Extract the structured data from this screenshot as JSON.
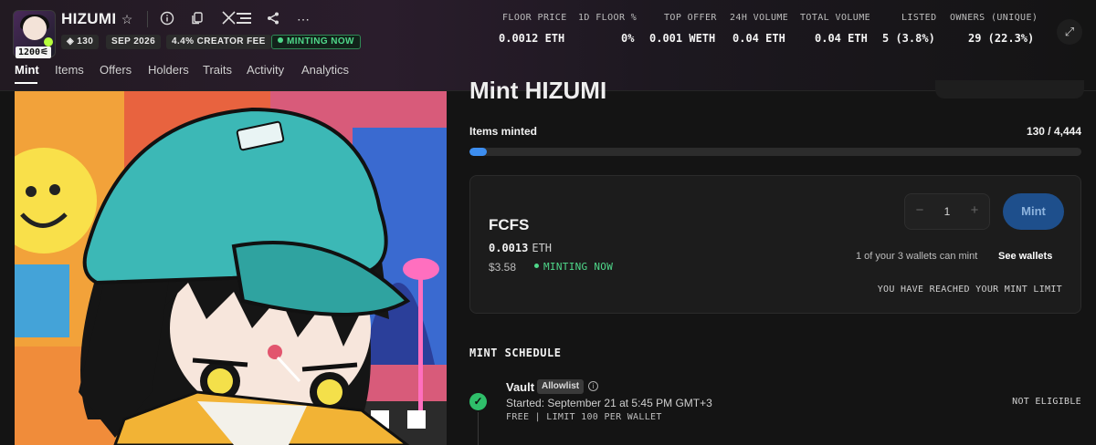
{
  "collection": {
    "name": "HIZUMI",
    "logo_badge": "1200⚟",
    "pills": {
      "items": "130",
      "date": "SEP 2026",
      "creator_fee": "4.4% CREATOR FEE",
      "status": "MINTING NOW"
    }
  },
  "header_icons": [
    "star-icon",
    "info-icon",
    "copy-icon",
    "x-icon",
    "link-icon",
    "share-icon",
    "more-icon"
  ],
  "stats": [
    {
      "label": "FLOOR PRICE",
      "value": "0.0012 ETH"
    },
    {
      "label": "1D FLOOR %",
      "value": "0%"
    },
    {
      "label": "TOP OFFER",
      "value": "0.001 WETH"
    },
    {
      "label": "24H VOLUME",
      "value": "0.04 ETH"
    },
    {
      "label": "TOTAL VOLUME",
      "value": "0.04 ETH"
    },
    {
      "label": "LISTED",
      "value": "5 (3.8%)"
    },
    {
      "label": "OWNERS (UNIQUE)",
      "value": "29 (22.3%)"
    }
  ],
  "tabs": [
    "Mint",
    "Items",
    "Offers",
    "Holders",
    "Traits",
    "Activity",
    "Analytics"
  ],
  "mint": {
    "heading": "Mint HIZUMI",
    "items_minted_label": "Items minted",
    "items_minted_count": "130 / 4,444",
    "progress_fraction": 0.029,
    "phase": {
      "name": "FCFS",
      "price": "0.0013",
      "currency": "ETH",
      "usd": "$3.58",
      "status": "MINTING NOW",
      "quantity": "1",
      "mint_label": "Mint",
      "wallet_note": "1 of your 3 wallets can mint",
      "see_wallets": "See wallets",
      "limit_message": "YOU HAVE REACHED YOUR MINT LIMIT"
    },
    "schedule": {
      "title": "MINT SCHEDULE",
      "stages": [
        {
          "name": "Vault",
          "badge": "Allowlist",
          "started": "Started: September 21 at 5:45 PM GMT+3",
          "limit": "FREE | LIMIT 100 PER WALLET",
          "eligibility": "NOT ELIGIBLE"
        }
      ]
    }
  },
  "colors": {
    "accent_blue": "#3d8ef0",
    "mint_button": "#1e4f8c",
    "minting_green": "#4fd88a",
    "success_green": "#2fbf6a"
  }
}
